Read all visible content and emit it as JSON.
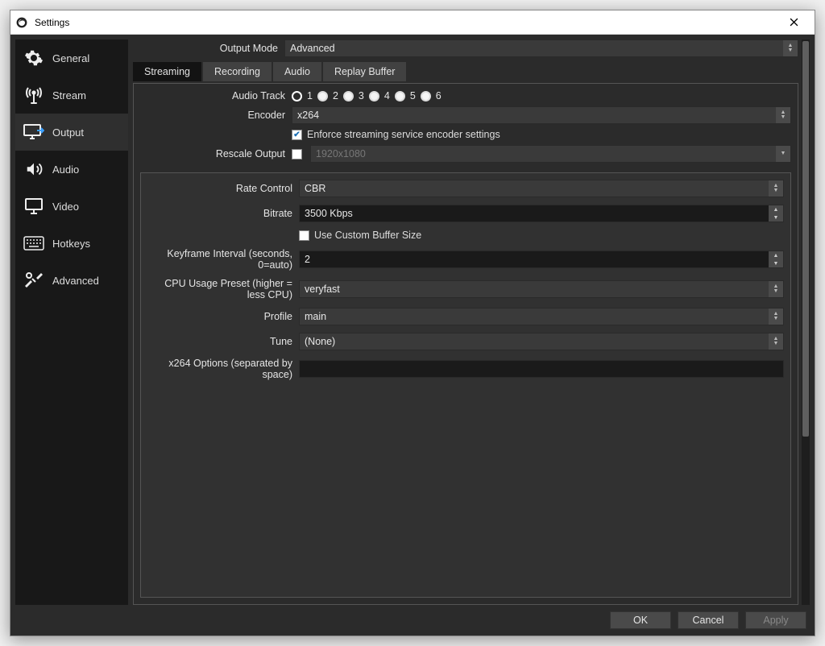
{
  "window": {
    "title": "Settings"
  },
  "sidebar": {
    "items": [
      {
        "label": "General"
      },
      {
        "label": "Stream"
      },
      {
        "label": "Output"
      },
      {
        "label": "Audio"
      },
      {
        "label": "Video"
      },
      {
        "label": "Hotkeys"
      },
      {
        "label": "Advanced"
      }
    ]
  },
  "output_mode": {
    "label": "Output Mode",
    "value": "Advanced"
  },
  "tabs": {
    "items": [
      {
        "label": "Streaming"
      },
      {
        "label": "Recording"
      },
      {
        "label": "Audio"
      },
      {
        "label": "Replay Buffer"
      }
    ]
  },
  "streaming": {
    "audio_track_label": "Audio Track",
    "tracks": [
      "1",
      "2",
      "3",
      "4",
      "5",
      "6"
    ],
    "encoder_label": "Encoder",
    "encoder_value": "x264",
    "enforce_label": "Enforce streaming service encoder settings",
    "rescale_label": "Rescale Output",
    "rescale_value": "1920x1080"
  },
  "encoder": {
    "rate_control_label": "Rate Control",
    "rate_control_value": "CBR",
    "bitrate_label": "Bitrate",
    "bitrate_value": "3500 Kbps",
    "custom_buffer_label": "Use Custom Buffer Size",
    "keyframe_label": "Keyframe Interval (seconds, 0=auto)",
    "keyframe_value": "2",
    "cpu_preset_label": "CPU Usage Preset (higher = less CPU)",
    "cpu_preset_value": "veryfast",
    "profile_label": "Profile",
    "profile_value": "main",
    "tune_label": "Tune",
    "tune_value": "(None)",
    "x264_opts_label": "x264 Options (separated by space)",
    "x264_opts_value": ""
  },
  "footer": {
    "ok": "OK",
    "cancel": "Cancel",
    "apply": "Apply"
  }
}
